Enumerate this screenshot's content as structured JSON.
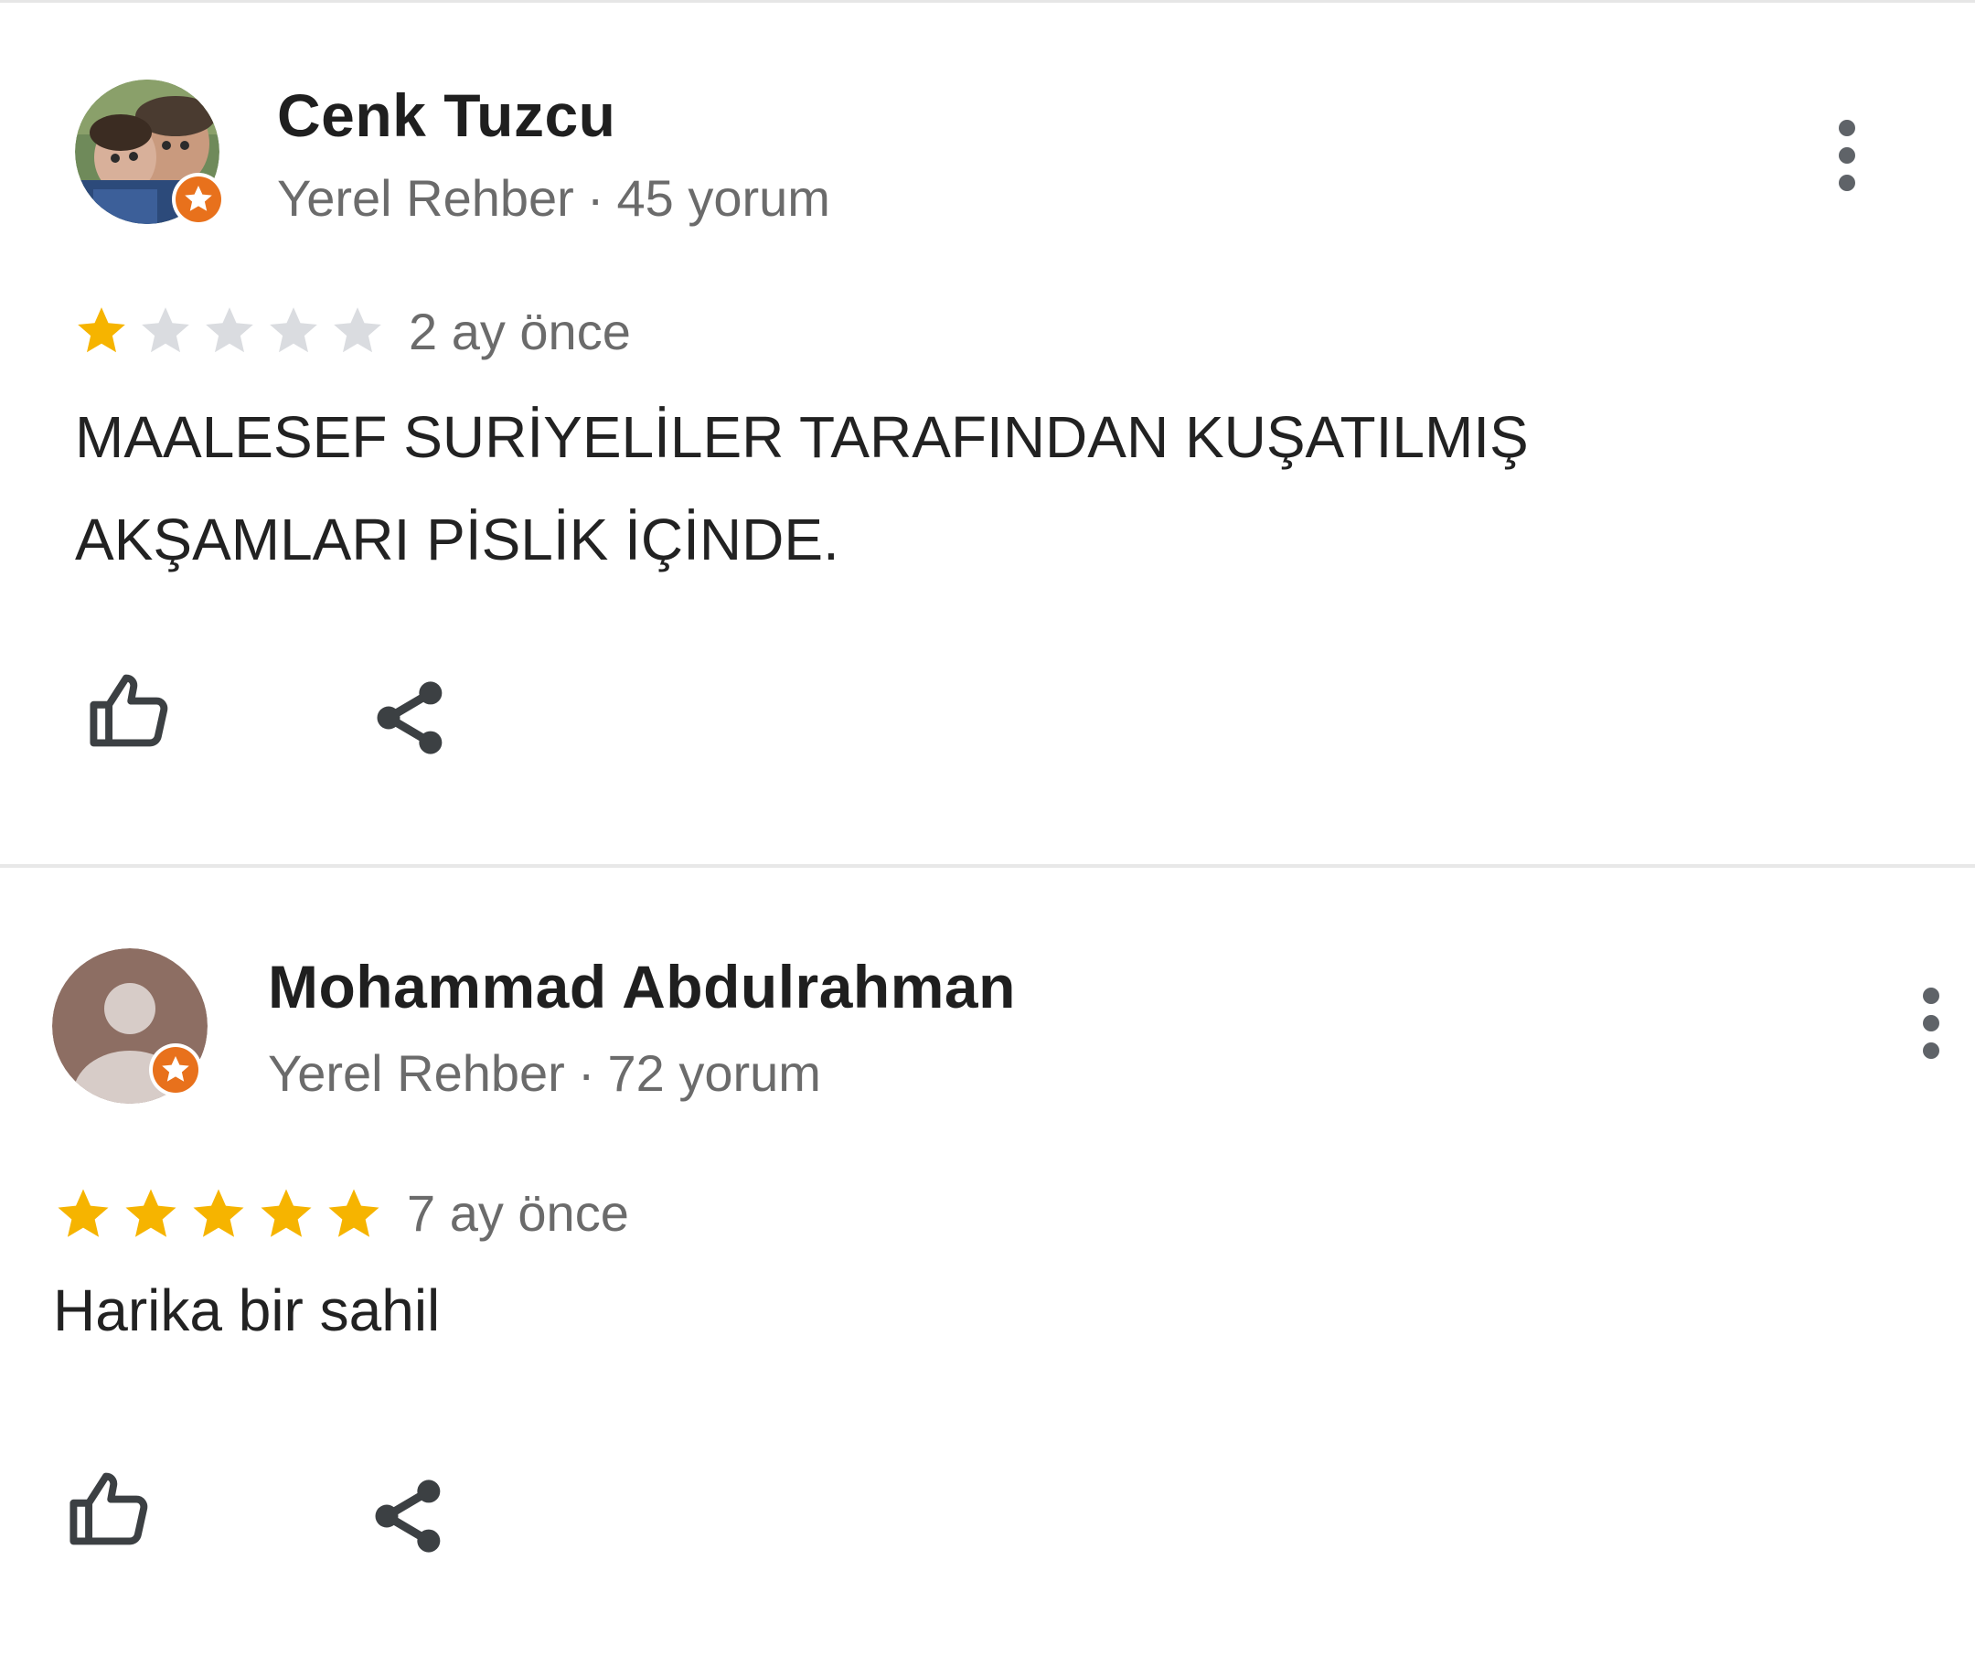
{
  "reviews": [
    {
      "author": "Cenk Tuzcu",
      "role": "Yerel Rehber",
      "review_count": "45 yorum",
      "rating": 1,
      "max_rating": 5,
      "time": "2 ay önce",
      "text": "MAALESEF SURİYELİLER TARAFINDAN KUŞATILMIŞ\nAKŞAMLARI PİSLİK İÇİNDE.",
      "avatar_icon": "user-photo-avatar",
      "badge_icon": "local-guide-star-icon"
    },
    {
      "author": "Mohammad Abdulrahman",
      "role": "Yerel Rehber",
      "review_count": "72 yorum",
      "rating": 5,
      "max_rating": 5,
      "time": "7 ay önce",
      "text": "Harika bir sahil",
      "avatar_icon": "default-person-avatar",
      "badge_icon": "local-guide-star-icon"
    }
  ],
  "meta_separator": "·",
  "colors": {
    "star_filled": "#f6b400",
    "star_empty": "#dadce0",
    "badge": "#e8711c",
    "text_secondary": "#6b6b6b"
  },
  "icons": {
    "like": "thumbs-up-icon",
    "share": "share-icon",
    "more": "more-vert-icon"
  }
}
